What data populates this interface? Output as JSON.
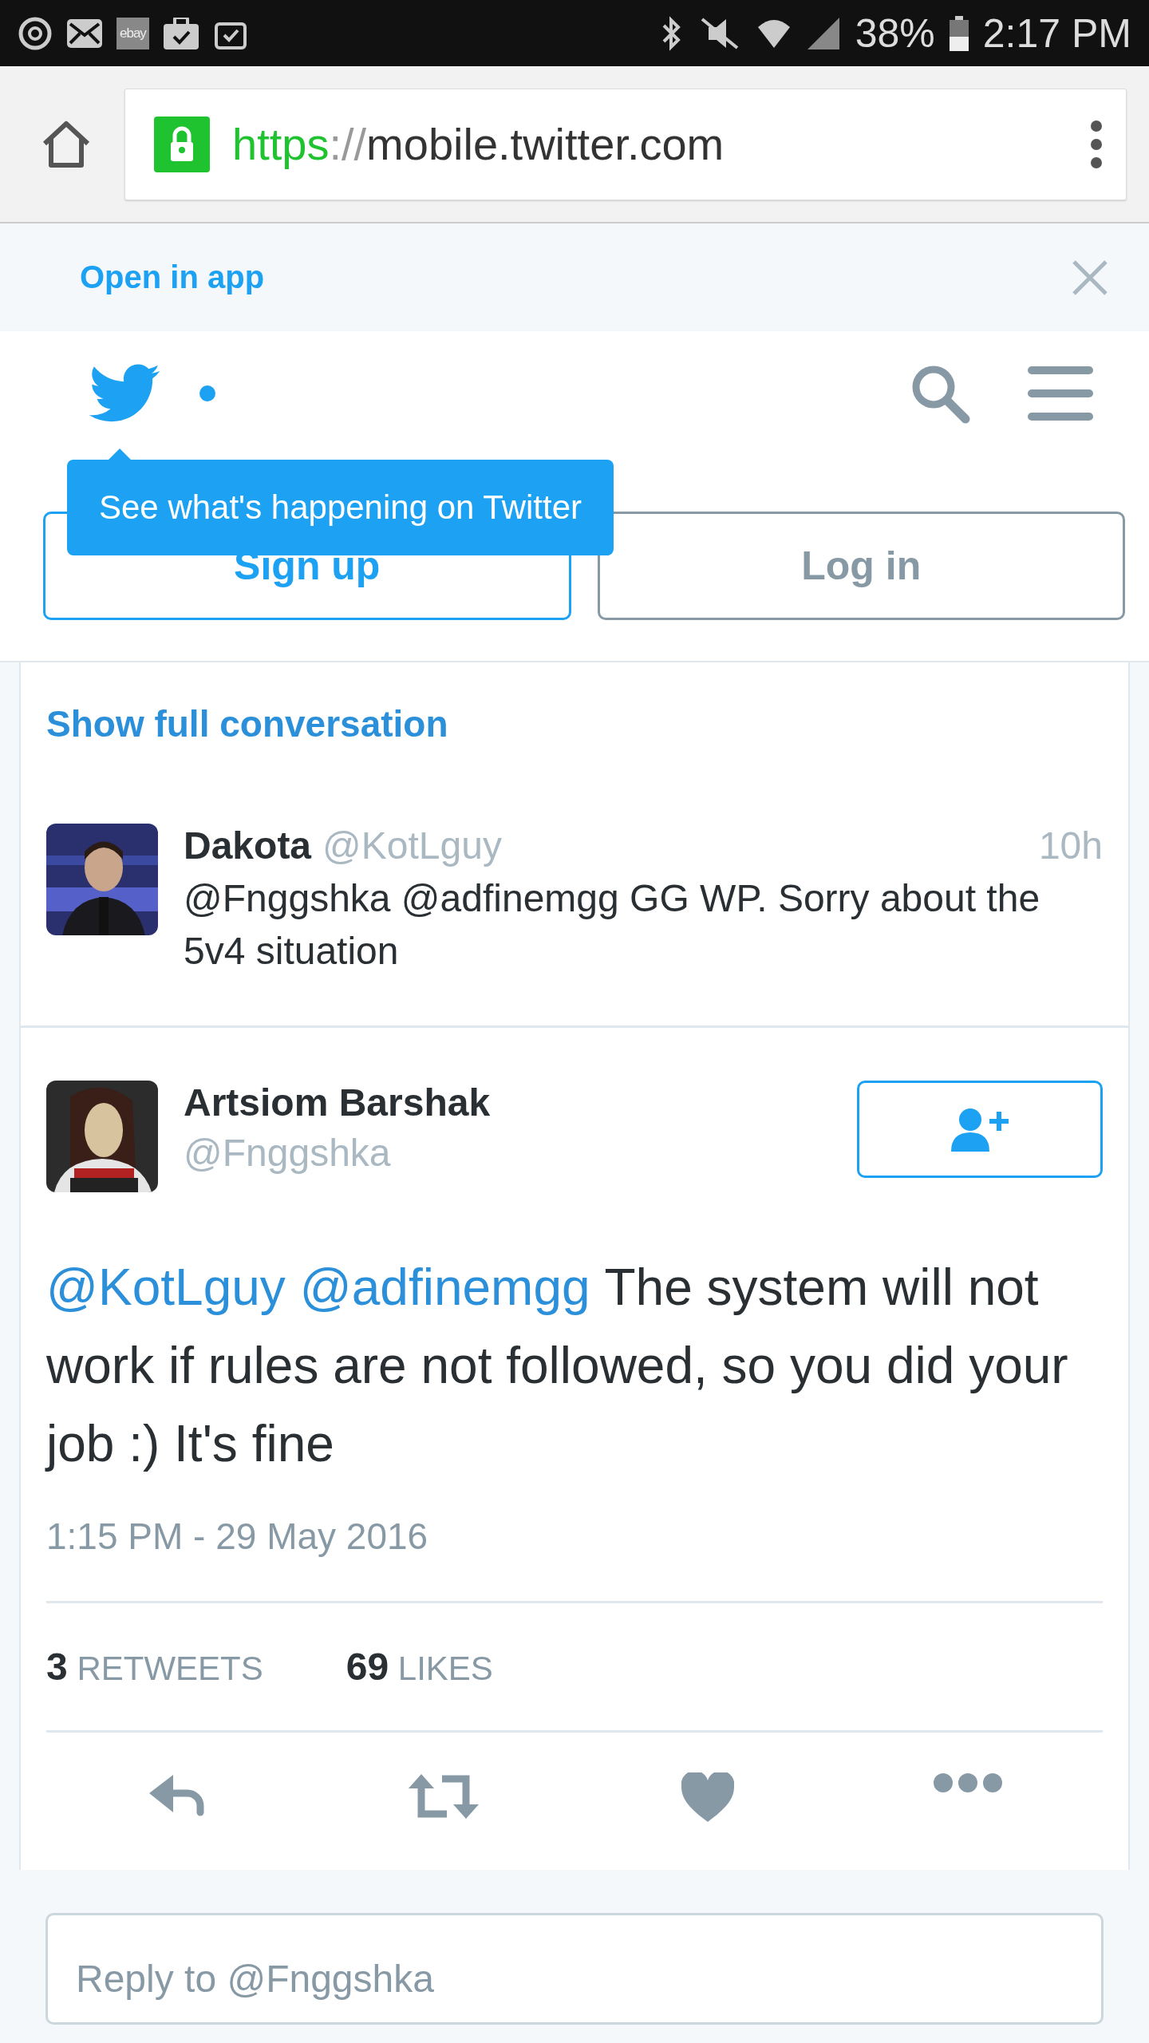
{
  "status_bar": {
    "notification_badge": "ebay",
    "battery": "38%",
    "time": "2:17 PM"
  },
  "browser": {
    "url_scheme": "https",
    "url_sep": "://",
    "url_host": "mobile.twitter.com"
  },
  "banner": {
    "open_in_app": "Open in app"
  },
  "header": {
    "tooltip": "See what's happening on Twitter",
    "sign_up": "Sign up",
    "log_in": "Log in"
  },
  "conversation": {
    "show_full": "Show full conversation",
    "reply_tweet": {
      "name": "Dakota",
      "handle": "@KotLguy",
      "time": "10h",
      "text": "@Fnggshka @adfinemgg GG WP. Sorry about the 5v4 situation"
    },
    "main_tweet": {
      "name": "Artsiom Barshak",
      "handle": "@Fnggshka",
      "text": [
        {
          "kind": "mention",
          "text": "@KotLguy"
        },
        {
          "kind": "mention",
          "text": "@adfinemgg"
        },
        {
          "kind": "plain",
          "text": "The system will not work if rules are not followed, so you did your job :) It's fine"
        }
      ],
      "timestamp": "1:15 PM - 29 May 2016",
      "stats": [
        {
          "count": "3",
          "label": "RETWEETS"
        },
        {
          "count": "69",
          "label": "LIKES"
        }
      ]
    },
    "reply_placeholder": "Reply to @Fnggshka"
  }
}
